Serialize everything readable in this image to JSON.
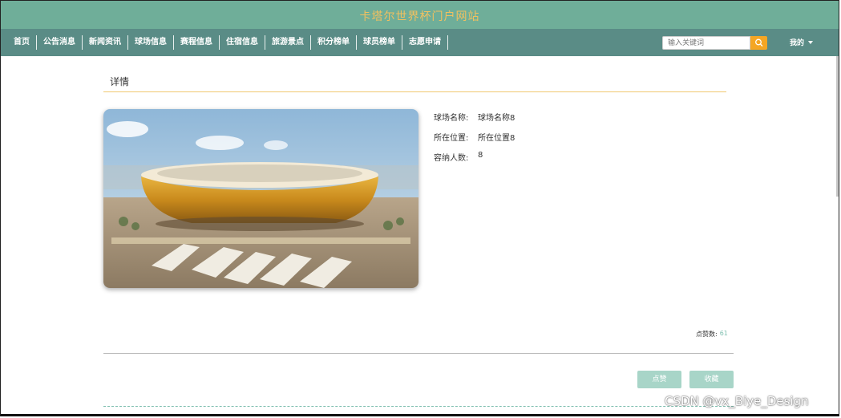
{
  "header": {
    "site_title": "卡塔尔世界杯门户网站"
  },
  "nav": {
    "items": [
      "首页",
      "公告消息",
      "新闻资讯",
      "球场信息",
      "赛程信息",
      "住宿信息",
      "旅游景点",
      "积分榜单",
      "球员榜单",
      "志愿申请"
    ],
    "search_placeholder": "输入关键词",
    "search_icon": "search-icon",
    "user_menu_label": "我的"
  },
  "detail": {
    "section_title": "详情",
    "image": "stadium-photo",
    "fields": [
      {
        "label": "球场名称:",
        "value": "球场名称8"
      },
      {
        "label": "所在位置:",
        "value": "所在位置8"
      },
      {
        "label": "容纳人数:",
        "value": "8"
      }
    ],
    "likes_label": "点赞数:",
    "likes_count": "61"
  },
  "actions": {
    "like_label": "点赞",
    "favorite_label": "收藏"
  },
  "watermark": "CSDN @vx_Biye_Design",
  "colors": {
    "header_bg": "#6fae99",
    "nav_bg": "#5a8c86",
    "title_text": "#f0c060",
    "button": "#a8d5c8",
    "search_button": "#f5a623"
  }
}
